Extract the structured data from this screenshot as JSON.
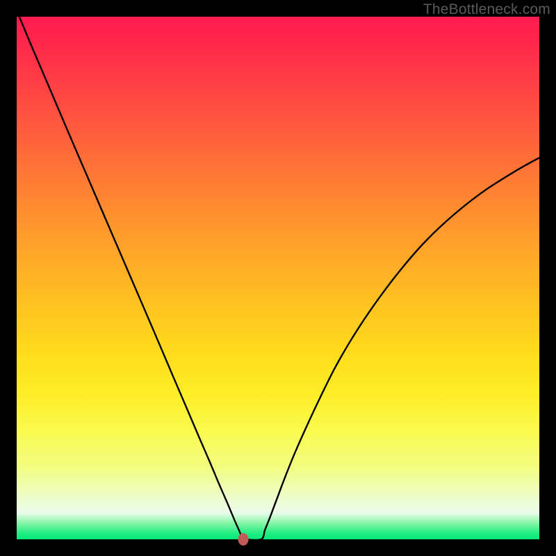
{
  "watermark": "TheBottleneck.com",
  "chart_data": {
    "type": "line",
    "title": "",
    "xlabel": "",
    "ylabel": "",
    "xlim": [
      0,
      100
    ],
    "ylim": [
      0,
      100
    ],
    "grid": false,
    "series": [
      {
        "name": "curve",
        "x": [
          0.5,
          3,
          6,
          10,
          14,
          18,
          22,
          26,
          30,
          33,
          35,
          37,
          38.5,
          39.5,
          40.5,
          41,
          41.8,
          42.6,
          43.1,
          43.6,
          46.8,
          47.5,
          48.5,
          49.7,
          51.2,
          53,
          55.2,
          58,
          61,
          64.5,
          68.5,
          73,
          78,
          83.5,
          89.5,
          96,
          100
        ],
        "y": [
          100,
          94,
          87,
          77.6,
          68.3,
          59,
          49.7,
          40.4,
          31,
          24,
          19.3,
          14.7,
          11.1,
          8.8,
          6.5,
          5.3,
          3.4,
          1.6,
          0.4,
          0,
          0,
          1.8,
          4.3,
          7.5,
          11.5,
          16,
          21,
          27,
          33,
          39,
          45,
          51,
          56.8,
          62,
          66.7,
          70.8,
          73
        ]
      }
    ],
    "marker": {
      "x": 43.35,
      "y": 0
    },
    "background_gradient": {
      "top": "#ff1a4f",
      "mid": "#ffd21f",
      "bottom": "#09e879"
    }
  }
}
